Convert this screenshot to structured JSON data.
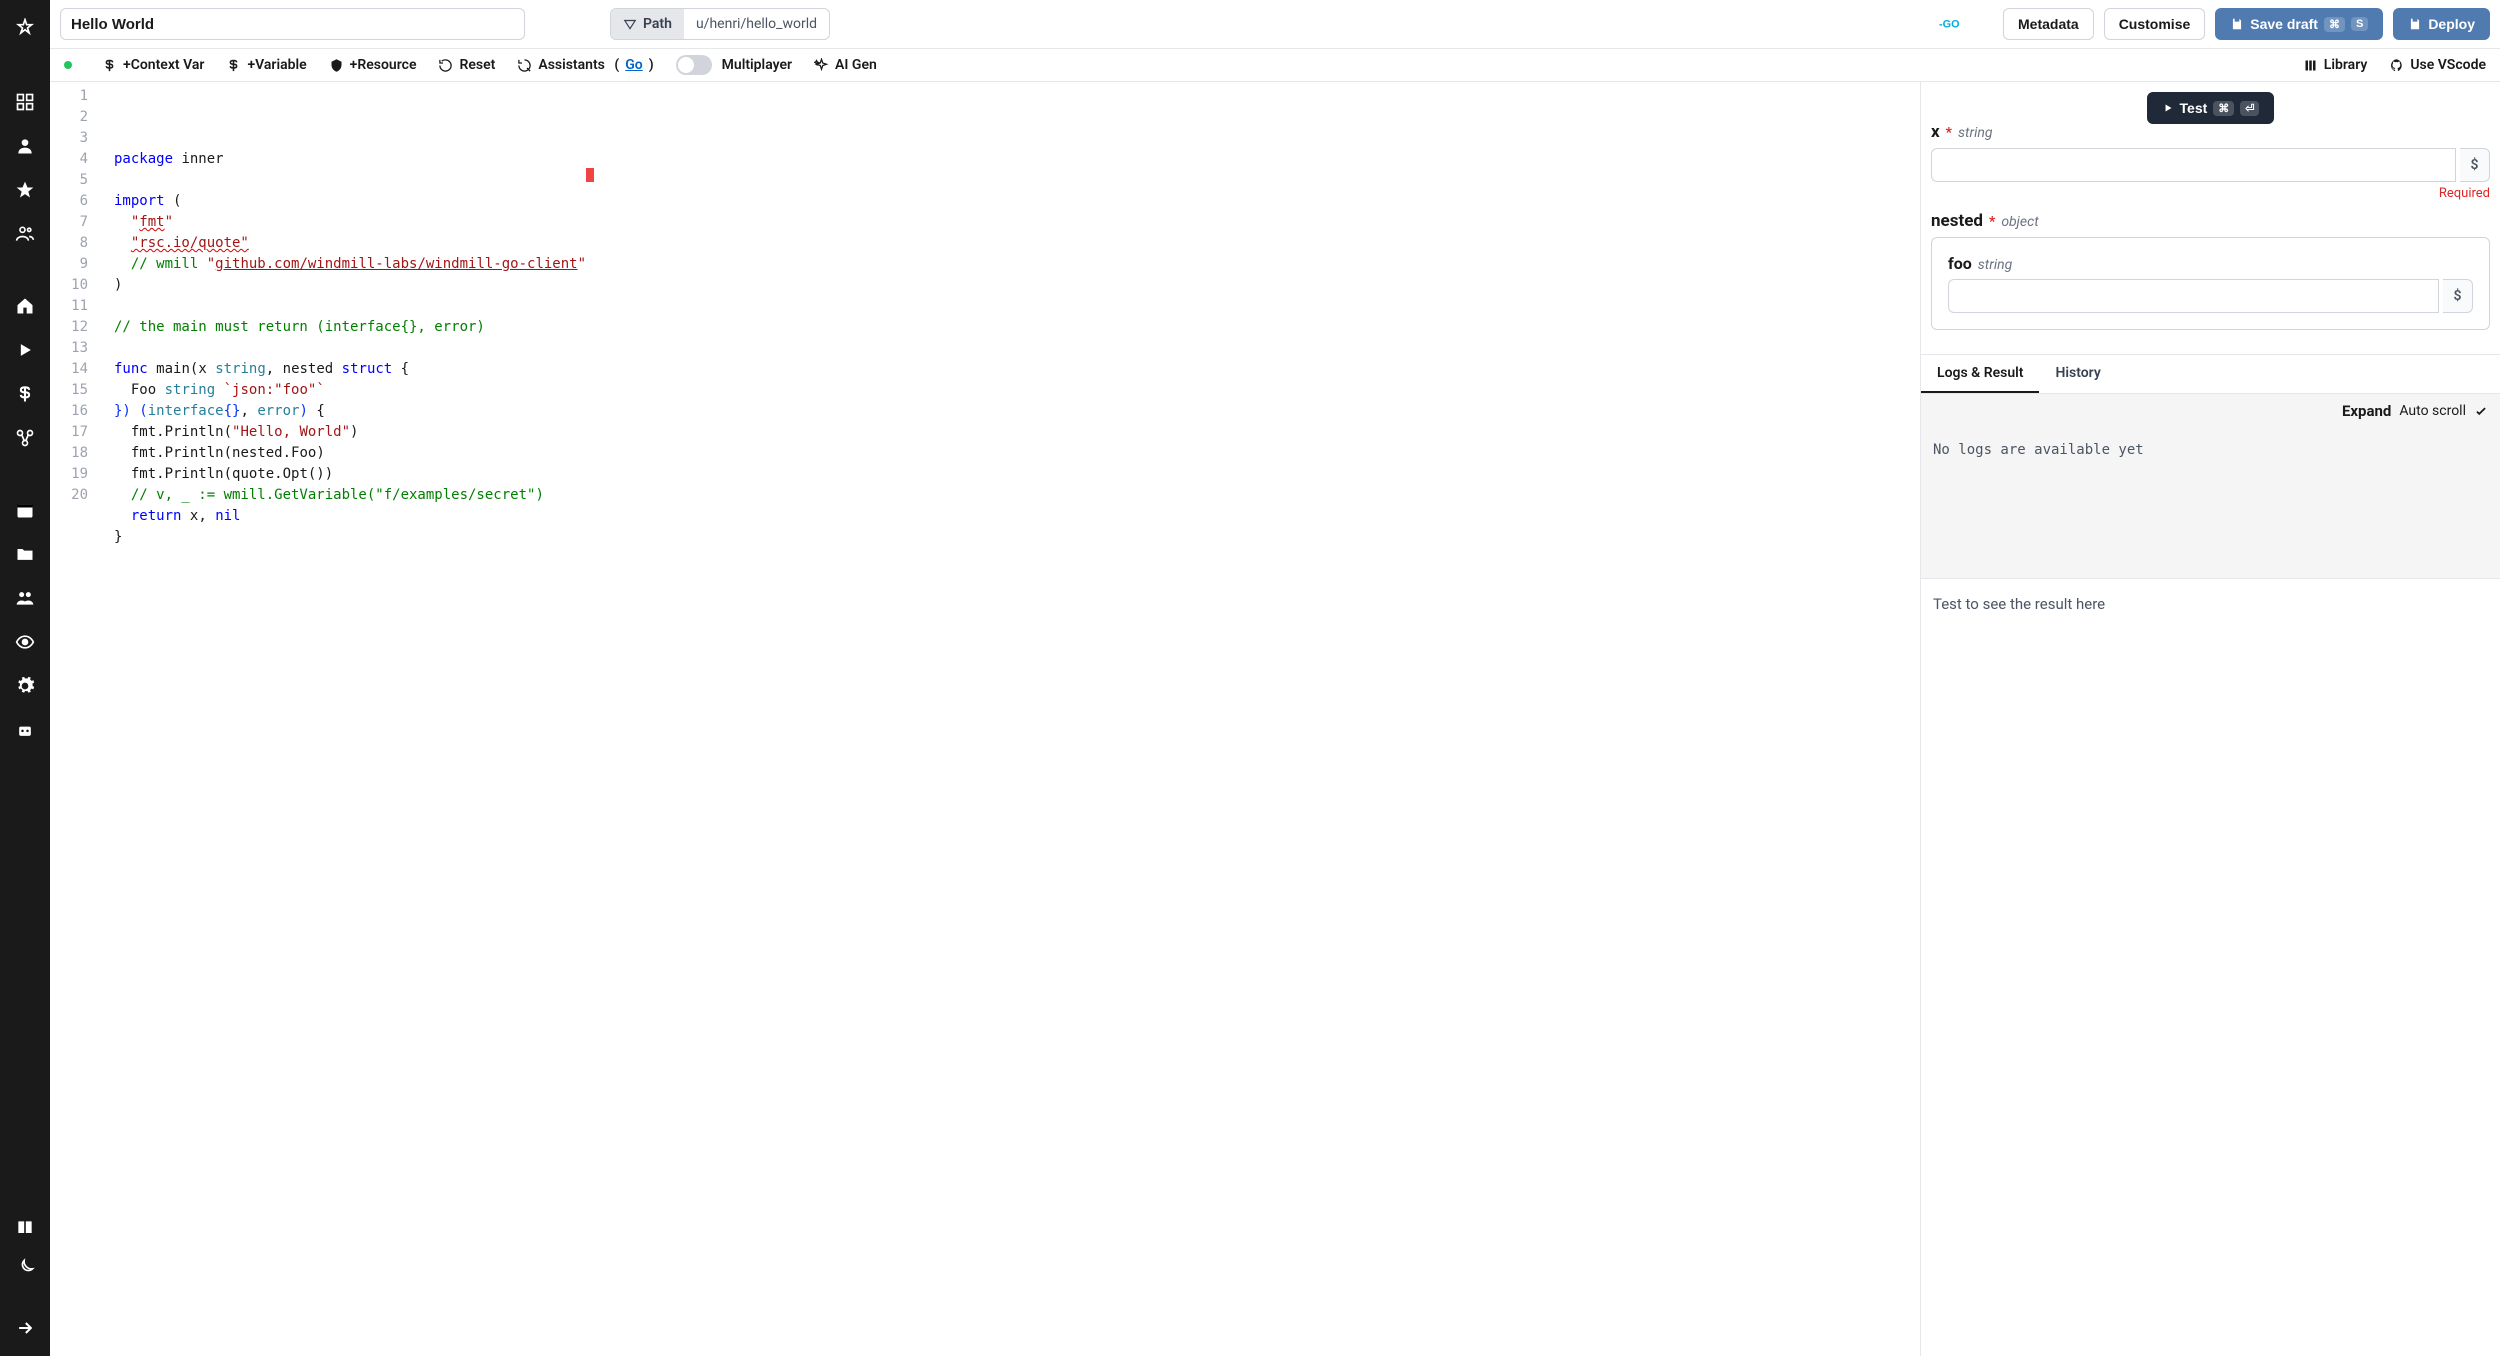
{
  "title": "Hello World",
  "path": {
    "label": "Path",
    "value": "u/henri/hello_world"
  },
  "topbar": {
    "metadata": "Metadata",
    "customise": "Customise",
    "save_draft": "Save draft",
    "deploy": "Deploy",
    "kbd_cmd": "⌘",
    "kbd_s": "S"
  },
  "toolbar": {
    "context_var": "+Context Var",
    "variable": "+Variable",
    "resource": "+Resource",
    "reset": "Reset",
    "assistants": "Assistants",
    "assistants_lang": "Go",
    "multiplayer": "Multiplayer",
    "ai_gen": "AI Gen",
    "library": "Library",
    "use_vscode": "Use VScode"
  },
  "code": {
    "lines": [
      {
        "n": 1,
        "html": "<span class='kw'>package</span> <span class='ident'>inner</span>"
      },
      {
        "n": 2,
        "html": ""
      },
      {
        "n": 3,
        "html": "<span class='kw'>import</span> <span class='pn'>(</span>"
      },
      {
        "n": 4,
        "html": "  <span class='str'>\"</span><span class='qstr'>fmt</span><span class='str'>\"</span>"
      },
      {
        "n": 5,
        "html": "  <span class='qstr'>\"rsc.io/quote\"</span>"
      },
      {
        "n": 6,
        "html": "  <span class='cmt'>// wmill </span><span class='str'>\"</span><span class='link-str'>github.com/windmill-labs/windmill-go-client</span><span class='str'>\"</span>"
      },
      {
        "n": 7,
        "html": "<span class='pn'>)</span>"
      },
      {
        "n": 8,
        "html": ""
      },
      {
        "n": 9,
        "html": "<span class='cmt'>// the main must return (interface{}, error)</span>"
      },
      {
        "n": 10,
        "html": ""
      },
      {
        "n": 11,
        "html": "<span class='kw'>func</span> <span class='ident'>main</span><span class='pn'>(</span><span class='ident'>x</span> <span class='type'>string</span><span class='pn'>,</span> <span class='ident'>nested</span> <span class='kw'>struct</span> <span class='pn'>{</span>"
      },
      {
        "n": 12,
        "html": "  <span class='ident'>Foo</span> <span class='type'>string</span> <span class='str'>`json:\"foo\"`</span>"
      },
      {
        "n": 13,
        "html": "<span class='punct-b'>})</span> <span class='punct-b'>(</span><span class='type'>interface</span><span class='punct-b'>{}</span><span class='pn'>,</span> <span class='type'>error</span><span class='punct-b'>)</span> <span class='pn'>{</span>"
      },
      {
        "n": 14,
        "html": "  <span class='ident'>fmt.Println</span><span class='pn'>(</span><span class='str'>\"Hello, World\"</span><span class='pn'>)</span>"
      },
      {
        "n": 15,
        "html": "  <span class='ident'>fmt.Println</span><span class='pn'>(</span><span class='ident'>nested.Foo</span><span class='pn'>)</span>"
      },
      {
        "n": 16,
        "html": "  <span class='ident'>fmt.Println</span><span class='pn'>(</span><span class='ident'>quote.Opt</span><span class='pn'>())</span>"
      },
      {
        "n": 17,
        "html": "  <span class='cmt'>// v, _ := wmill.GetVariable(\"f/examples/secret\")</span>"
      },
      {
        "n": 18,
        "html": "  <span class='kw'>return</span> <span class='ident'>x</span><span class='pn'>,</span> <span class='kw'>nil</span>"
      },
      {
        "n": 19,
        "html": "<span class='pn'>}</span>"
      },
      {
        "n": 20,
        "html": ""
      }
    ]
  },
  "test_button": "Test",
  "params": {
    "x": {
      "name": "x",
      "type": "string",
      "required": true,
      "error": "Required"
    },
    "nested": {
      "name": "nested",
      "type": "object",
      "foo": {
        "name": "foo",
        "type": "string"
      }
    }
  },
  "logs": {
    "tabs": {
      "logs_result": "Logs & Result",
      "history": "History"
    },
    "expand": "Expand",
    "auto_scroll": "Auto scroll",
    "empty_logs": "No logs are available yet",
    "empty_result": "Test to see the result here"
  },
  "dollar": "$"
}
